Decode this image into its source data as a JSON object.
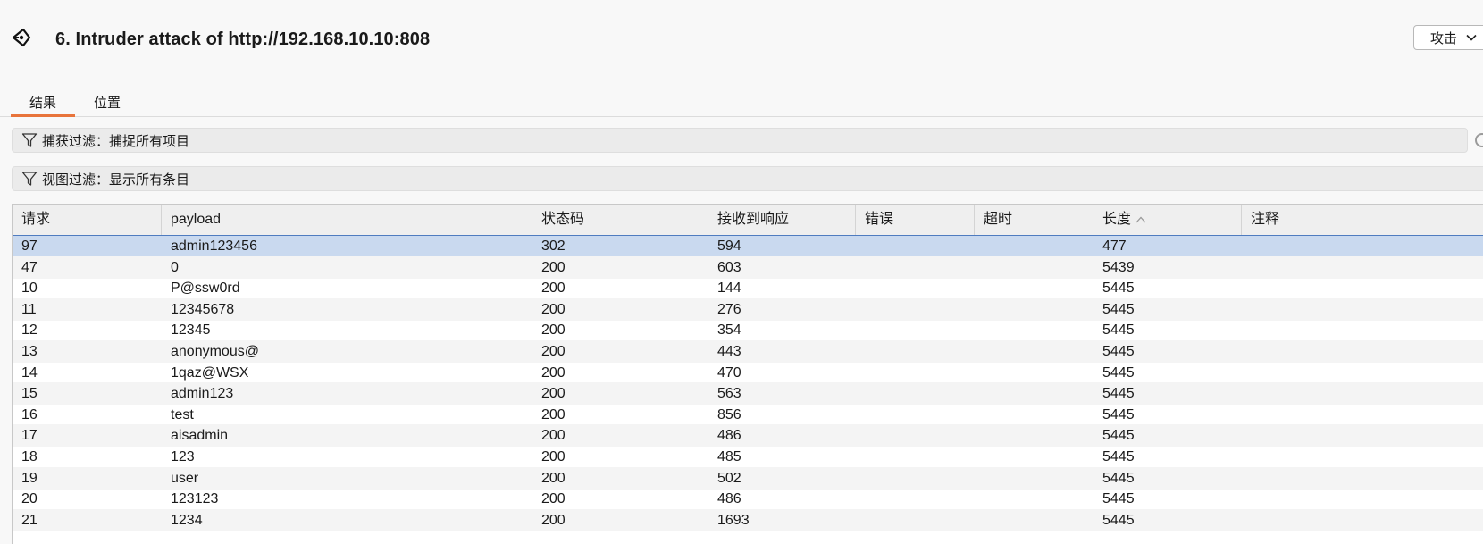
{
  "window": {
    "title": "6. Intruder attack of http://192.168.10.10:808",
    "attack_menu_label": "攻击"
  },
  "tabs": [
    {
      "label": "结果",
      "active": true
    },
    {
      "label": "位置",
      "active": false
    }
  ],
  "filters": {
    "capture": "捕获过滤：捕捉所有项目",
    "view": "视图过滤：显示所有条目"
  },
  "colors": {
    "accent_tab_underline": "#e8743b",
    "selected_row": "#c9d9ef",
    "selected_row_border": "#4f7cc0"
  },
  "table": {
    "columns": [
      "请求",
      "payload",
      "状态码",
      "接收到响应",
      "错误",
      "超时",
      "长度",
      "注释"
    ],
    "sorted_column": "长度",
    "sort_direction": "ascending",
    "rows": [
      [
        "97",
        "admin123456",
        "302",
        "594",
        "",
        "",
        "477",
        ""
      ],
      [
        "47",
        "0",
        "200",
        "603",
        "",
        "",
        "5439",
        ""
      ],
      [
        "10",
        "P@ssw0rd",
        "200",
        "144",
        "",
        "",
        "5445",
        ""
      ],
      [
        "11",
        "12345678",
        "200",
        "276",
        "",
        "",
        "5445",
        ""
      ],
      [
        "12",
        "12345",
        "200",
        "354",
        "",
        "",
        "5445",
        ""
      ],
      [
        "13",
        "anonymous@",
        "200",
        "443",
        "",
        "",
        "5445",
        ""
      ],
      [
        "14",
        "1qaz@WSX",
        "200",
        "470",
        "",
        "",
        "5445",
        ""
      ],
      [
        "15",
        "admin123",
        "200",
        "563",
        "",
        "",
        "5445",
        ""
      ],
      [
        "16",
        "test",
        "200",
        "856",
        "",
        "",
        "5445",
        ""
      ],
      [
        "17",
        "aisadmin",
        "200",
        "486",
        "",
        "",
        "5445",
        ""
      ],
      [
        "18",
        "123",
        "200",
        "485",
        "",
        "",
        "5445",
        ""
      ],
      [
        "19",
        "user",
        "200",
        "502",
        "",
        "",
        "5445",
        ""
      ],
      [
        "20",
        "123123",
        "200",
        "486",
        "",
        "",
        "5445",
        ""
      ],
      [
        "21",
        "1234",
        "200",
        "1693",
        "",
        "",
        "5445",
        ""
      ]
    ]
  }
}
